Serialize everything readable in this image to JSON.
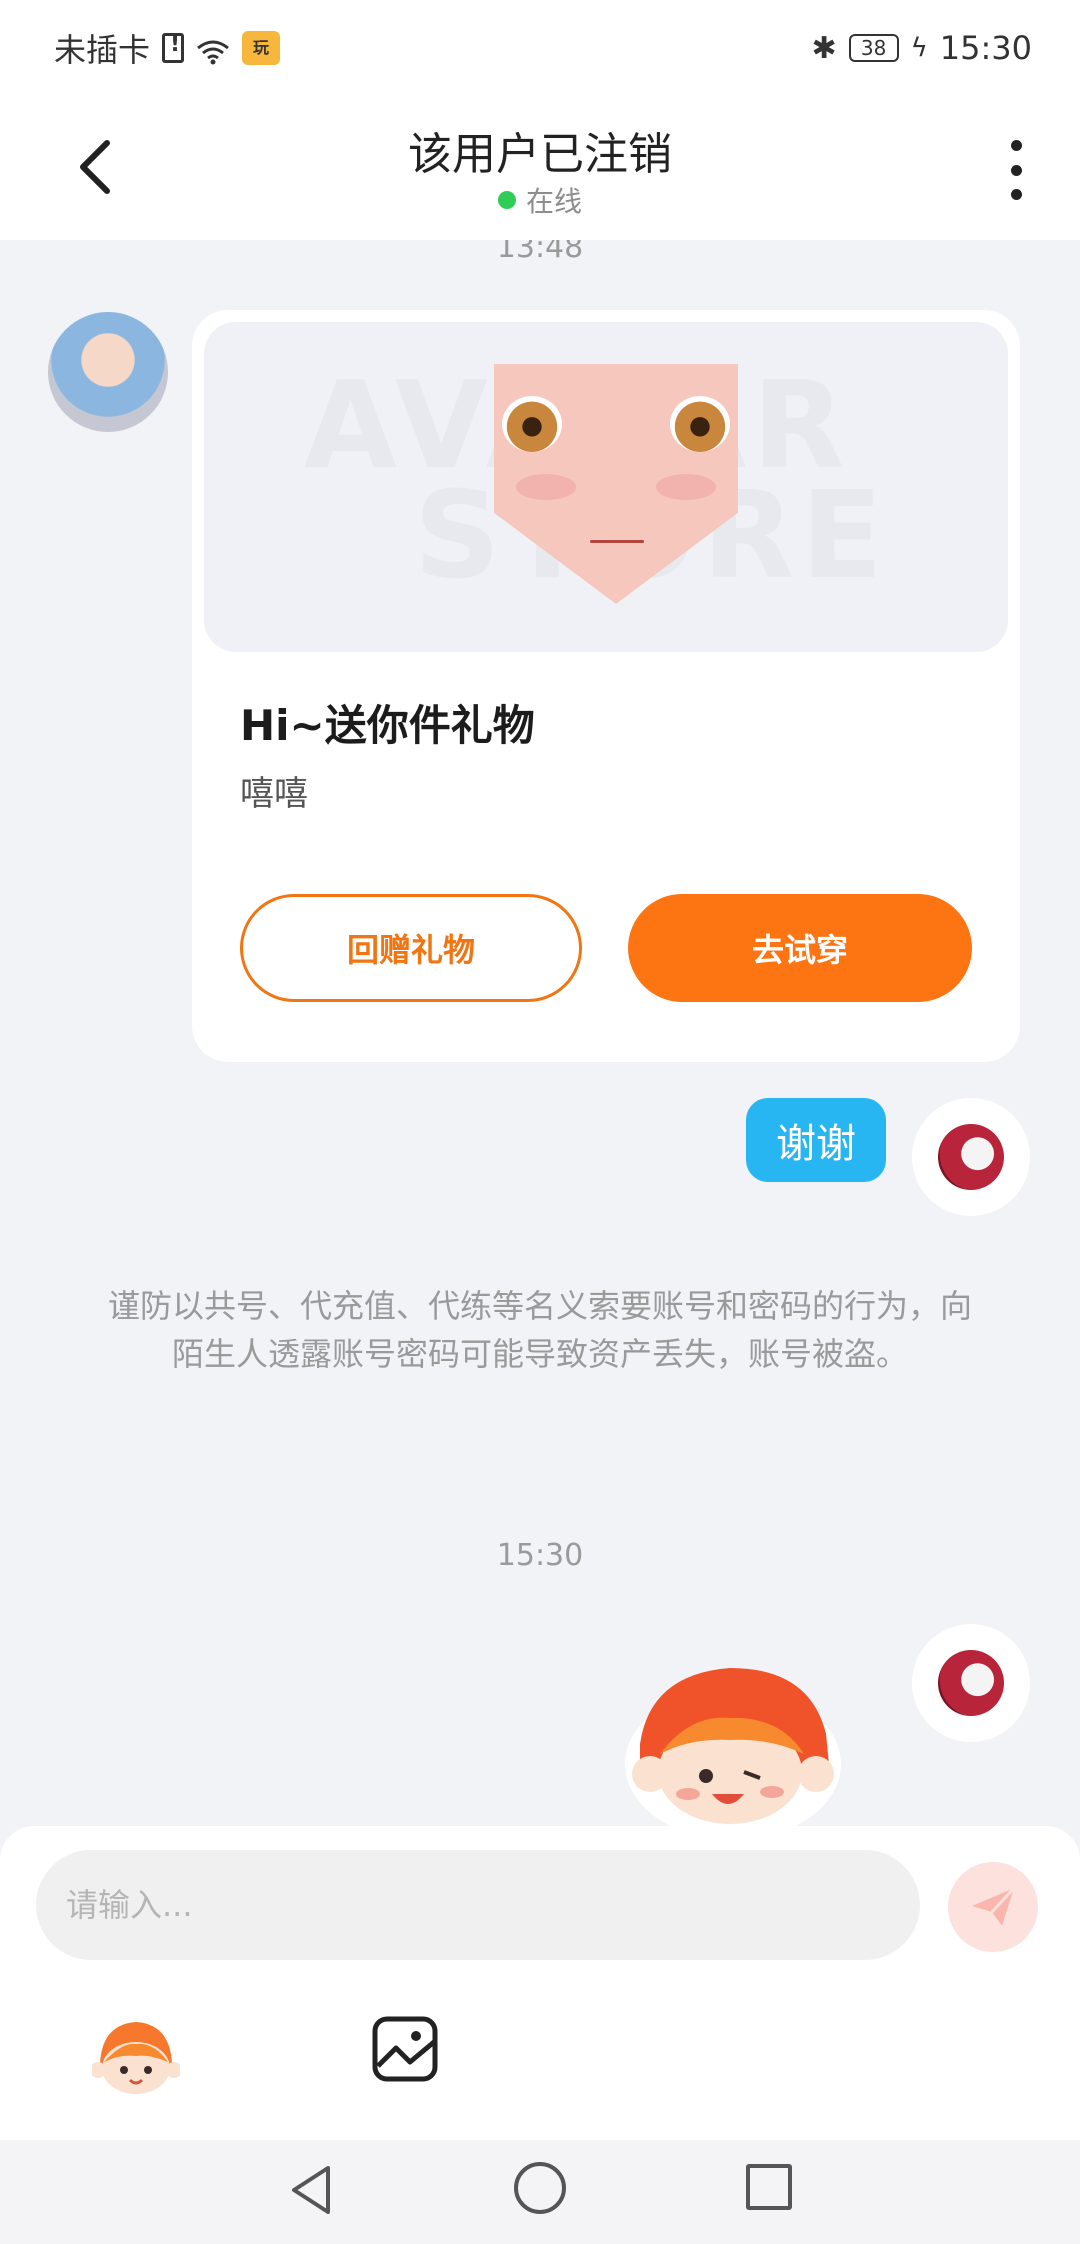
{
  "status_bar": {
    "carrier": "未插卡",
    "app_badge": "玩",
    "battery": "38",
    "time": "15:30"
  },
  "header": {
    "title": "该用户已注销",
    "status": "在线"
  },
  "chat": {
    "timestamp_top": "13:48",
    "gift_card": {
      "watermark_line1": "AVATAR",
      "watermark_line2": "STORE",
      "title": "Hi~送你件礼物",
      "subtitle": "嘻嘻",
      "return_gift_label": "回赠礼物",
      "try_on_label": "去试穿"
    },
    "self_message": "谢谢",
    "notice": "谨防以共号、代充值、代练等名义索要账号和密码的行为，向陌生人透露账号密码可能导致资产丢失，账号被盗。",
    "timestamp_bottom": "15:30"
  },
  "input_bar": {
    "placeholder": "请输入..."
  },
  "colors": {
    "accent_orange": "#fd7513",
    "bubble_blue": "#28b6f2",
    "online_green": "#2fcc56"
  },
  "icons": [
    "back-arrow-icon",
    "more-vertical-icon",
    "send-icon",
    "emoji-sticker-icon",
    "image-icon",
    "nav-back-icon",
    "nav-home-icon",
    "nav-recent-icon"
  ]
}
